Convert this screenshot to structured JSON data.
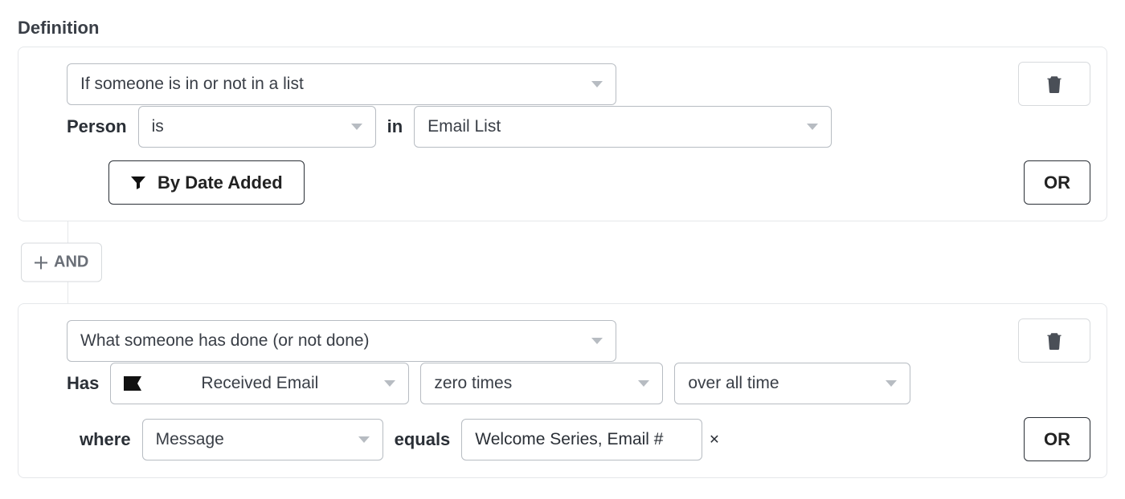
{
  "header": {
    "title": "Definition"
  },
  "connector": {
    "and_label": "AND"
  },
  "block1": {
    "condition_type": "If someone is in or not in a list",
    "person_label": "Person",
    "is_value": "is",
    "in_label": "in",
    "list_value": "Email List",
    "by_date_added_label": "By Date Added",
    "or_label": "OR"
  },
  "block2": {
    "condition_type": "What someone has done (or not done)",
    "has_label": "Has",
    "event_value": "Received Email",
    "times_value": "zero times",
    "range_value": "over all time",
    "where_label": "where",
    "message_label": "Message",
    "equals_label": "equals",
    "message_value": "Welcome Series, Email #",
    "or_label": "OR"
  }
}
